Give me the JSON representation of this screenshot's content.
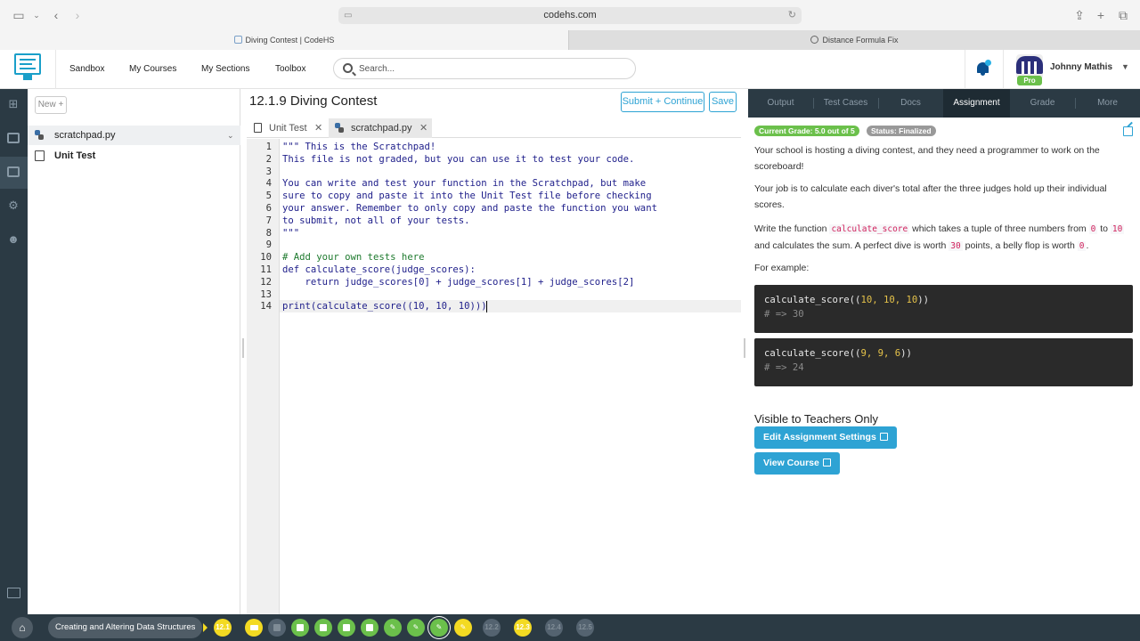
{
  "browser": {
    "url": "codehs.com",
    "tabs": [
      {
        "title": "Diving Contest | CodeHS",
        "active": true
      },
      {
        "title": "Distance Formula Fix",
        "active": false
      }
    ]
  },
  "header": {
    "nav": [
      "Sandbox",
      "My Courses",
      "My Sections",
      "Toolbox"
    ],
    "search_placeholder": "Search...",
    "user_name": "Johnny Mathis",
    "user_badge": "Pro"
  },
  "files": {
    "new_label": "New +",
    "items": [
      "scratchpad.py",
      "Unit Test"
    ]
  },
  "editor": {
    "title": "12.1.9 Diving Contest",
    "submit_label": "Submit + Continue",
    "save_label": "Save",
    "tabs": [
      "Unit Test",
      "scratchpad.py"
    ],
    "lines": [
      {
        "n": "1",
        "text": "\"\"\" This is the Scratchpad!"
      },
      {
        "n": "2",
        "text": "This file is not graded, but you can use it to test your code."
      },
      {
        "n": "3",
        "text": ""
      },
      {
        "n": "4",
        "text": "You can write and test your function in the Scratchpad, but make"
      },
      {
        "n": "5",
        "text": "sure to copy and paste it into the Unit Test file before checking"
      },
      {
        "n": "6",
        "text": "your answer. Remember to only copy and paste the function you want"
      },
      {
        "n": "7",
        "text": "to submit, not all of your tests."
      },
      {
        "n": "8",
        "text": "\"\"\""
      },
      {
        "n": "9",
        "text": ""
      },
      {
        "n": "10",
        "text": "# Add your own tests here"
      },
      {
        "n": "11",
        "text": "def calculate_score(judge_scores):"
      },
      {
        "n": "12",
        "text": "    return judge_scores[0] + judge_scores[1] + judge_scores[2]"
      },
      {
        "n": "13",
        "text": ""
      },
      {
        "n": "14",
        "text": "print(calculate_score((10, 10, 10)))"
      }
    ]
  },
  "panel": {
    "tabs": [
      "Output",
      "Test Cases",
      "Docs",
      "Assignment",
      "Grade",
      "More"
    ],
    "active_tab": "Assignment",
    "grade_badge": "Current Grade: 5.0 out of 5",
    "status_badge": "Status: Finalized",
    "p1": "Your school is hosting a diving contest, and they need a programmer to work on the scoreboard!",
    "p2": "Your job is to calculate each diver's total after the three judges hold up their individual scores.",
    "p3_a": "Write the function ",
    "p3_code": "calculate_score",
    "p3_b": " which takes a tuple of three numbers from ",
    "p3_c0": "0",
    "p3_c": " to ",
    "p3_c10": "10",
    "p3_d": " and calculates the sum. A perfect dive is worth ",
    "p3_c30": "30",
    "p3_e": " points, a belly flop is worth ",
    "p3_c0b": "0",
    "p3_f": ".",
    "p4": "For example:",
    "ex1_call": "calculate_score((",
    "ex1_args": "10, 10, 10",
    "ex1_close": "))",
    "ex1_out": "# => 30",
    "ex2_call": "calculate_score((",
    "ex2_args": "9, 9, 6",
    "ex2_close": "))",
    "ex2_out": "# => 24",
    "teacher_heading": "Visible to Teachers Only",
    "edit_btn": "Edit Assignment Settings",
    "view_btn": "View Course"
  },
  "bottom": {
    "crumb": "Creating and Altering Data Structures",
    "items": [
      "12.1",
      "12.2",
      "12.3",
      "12.4",
      "12.5"
    ]
  },
  "colors": {
    "accent": "#2ea3d4",
    "dark": "#2b3a44",
    "green": "#6bc04b",
    "yellow": "#f3da22"
  }
}
